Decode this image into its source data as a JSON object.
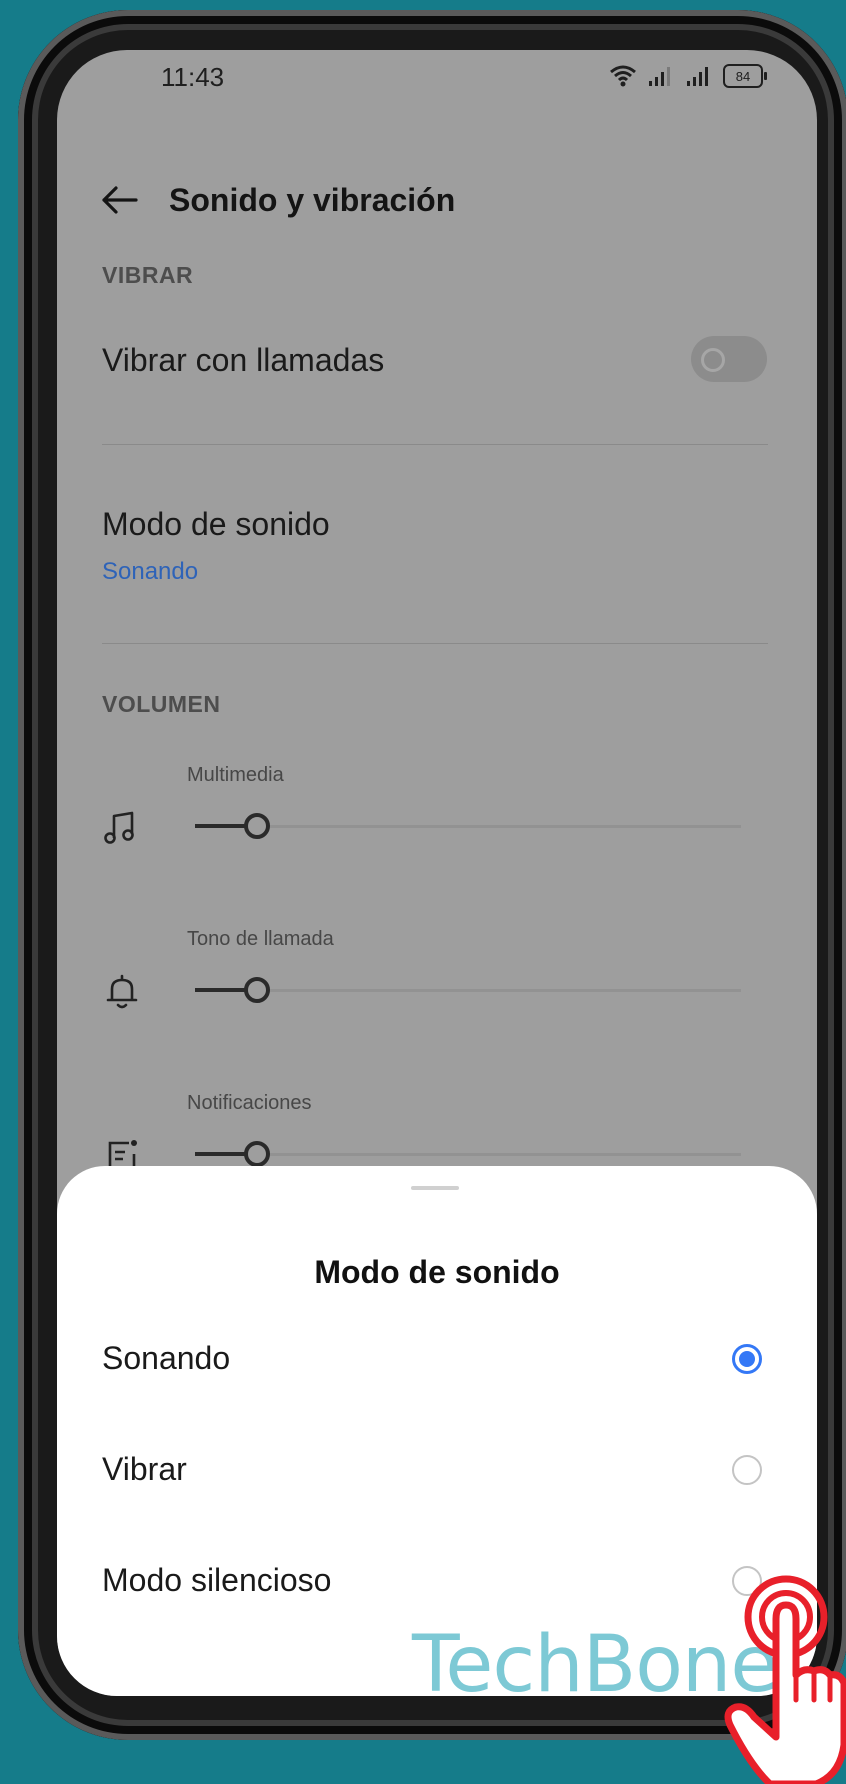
{
  "status_bar": {
    "time": "11:43",
    "battery": "84"
  },
  "header": {
    "title": "Sonido y vibración"
  },
  "sections": {
    "vibrate_label": "VIBRAR",
    "vibrate_with_calls": "Vibrar con llamadas",
    "sound_mode_title": "Modo de sonido",
    "sound_mode_value": "Sonando",
    "volume_label": "VOLUMEN"
  },
  "volume": {
    "multimedia": {
      "label": "Multimedia",
      "level": 0.11
    },
    "ringtone": {
      "label": "Tono de llamada",
      "level": 0.11
    },
    "notifications": {
      "label": "Notificaciones",
      "level": 0.11
    }
  },
  "sheet": {
    "title": "Modo de sonido",
    "options": [
      {
        "label": "Sonando",
        "selected": true
      },
      {
        "label": "Vibrar",
        "selected": false
      },
      {
        "label": "Modo silencioso",
        "selected": false
      }
    ]
  },
  "watermark": "TechBone",
  "colors": {
    "accent": "#3478f6",
    "link": "#2e63b8",
    "background": "#157c8a",
    "watermark": "#6fc4d1",
    "hand": "#e8202a"
  }
}
